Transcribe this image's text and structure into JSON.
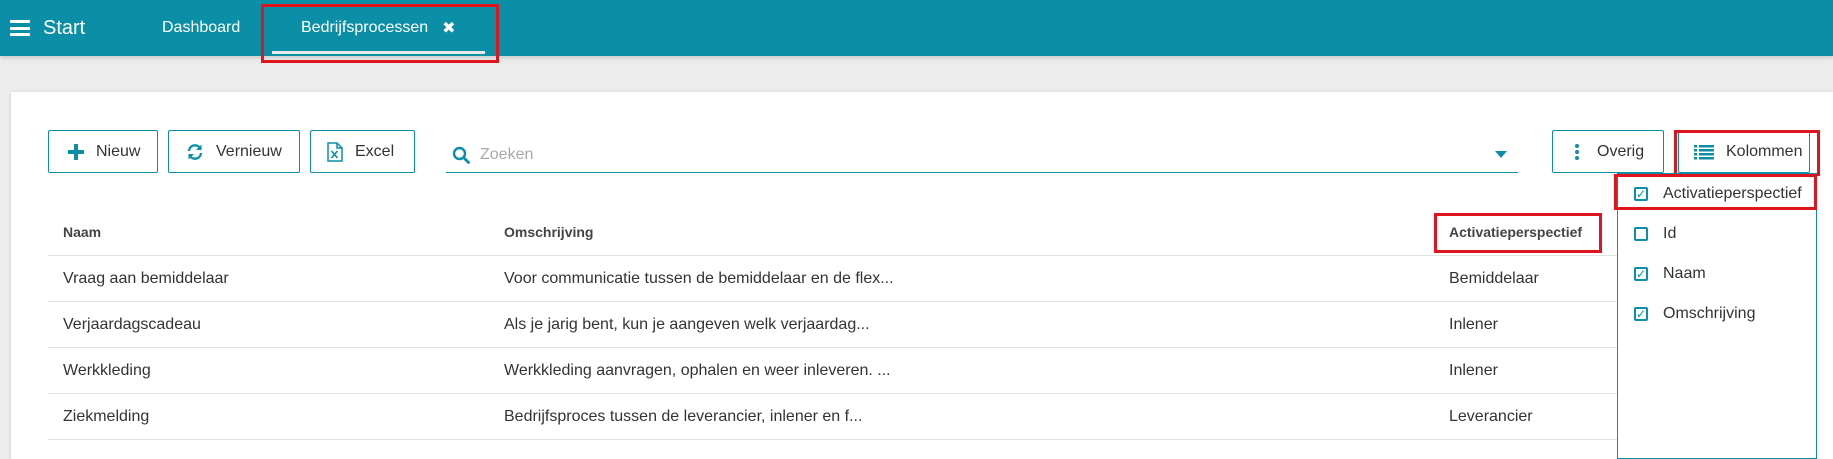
{
  "topbar": {
    "start_label": "Start",
    "tabs": [
      {
        "label": "Dashboard"
      },
      {
        "label": "Bedrijfsprocessen"
      }
    ],
    "close_glyph": "✖"
  },
  "toolbar": {
    "new_label": "Nieuw",
    "refresh_label": "Vernieuw",
    "excel_label": "Excel",
    "search_placeholder": "Zoeken",
    "other_label": "Overig",
    "columns_label": "Kolommen"
  },
  "table": {
    "headers": [
      "Naam",
      "Omschrijving",
      "Activatieperspectief"
    ],
    "rows": [
      [
        "Vraag aan bemiddelaar",
        "Voor communicatie tussen de bemiddelaar en de flex...",
        "Bemiddelaar"
      ],
      [
        "Verjaardagscadeau",
        "Als je jarig bent, kun je aangeven welk verjaardag...",
        "Inlener"
      ],
      [
        "Werkkleding",
        "Werkkleding aanvragen, ophalen en weer inleveren. ...",
        "Inlener"
      ],
      [
        "Ziekmelding",
        "Bedrijfsproces tussen de leverancier, inlener en f...",
        "Leverancier"
      ]
    ]
  },
  "columns_menu": {
    "items": [
      {
        "label": "Activatieperspectief",
        "checked": true
      },
      {
        "label": "Id",
        "checked": false
      },
      {
        "label": "Naam",
        "checked": true
      },
      {
        "label": "Omschrijving",
        "checked": true
      }
    ]
  },
  "colors": {
    "primary": "#0a8fa6",
    "highlight": "#e0141e"
  }
}
